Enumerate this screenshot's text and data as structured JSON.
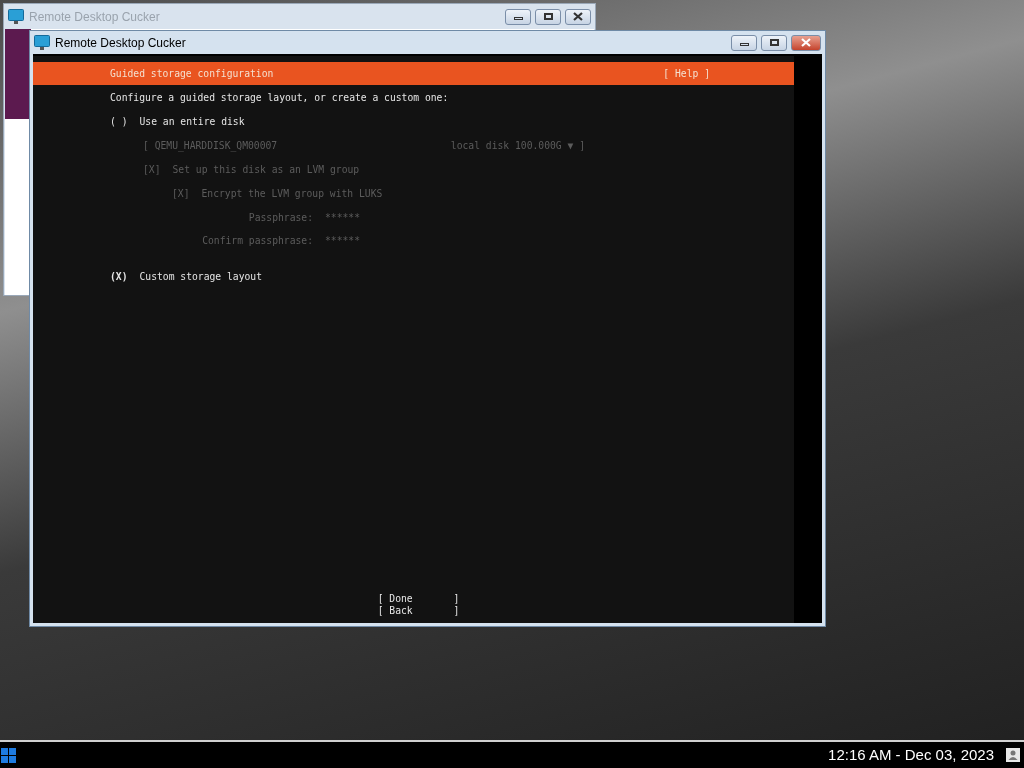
{
  "back_window": {
    "title": "Remote Desktop Cucker"
  },
  "window": {
    "title": "Remote Desktop Cucker"
  },
  "installer": {
    "header": {
      "title": "Guided storage configuration",
      "help": "[ Help ]"
    },
    "intro": "Configure a guided storage layout, or create a custom one:",
    "options": [
      {
        "marker": "( )",
        "label": "Use an entire disk",
        "selected": false,
        "disk": {
          "name": "[ QEMU_HARDDISK_QM00007",
          "size": "local disk 100.000G ▼ ]",
          "disabled": true
        },
        "lvm": {
          "marker": "[X]",
          "label": "Set up this disk as an LVM group",
          "checked": true,
          "disabled": true,
          "encrypt": {
            "marker": "[X]",
            "label": "Encrypt the LVM group with LUKS",
            "checked": true,
            "disabled": true,
            "fields": [
              {
                "label": "Passphrase:",
                "value": "******",
                "disabled": true
              },
              {
                "label": "Confirm passphrase:",
                "value": "******",
                "disabled": true
              }
            ]
          }
        }
      },
      {
        "marker": "(X)",
        "label": "Custom storage layout",
        "selected": true
      }
    ],
    "buttons": [
      "[ Done       ]",
      "[ Back       ]"
    ]
  },
  "taskbar": {
    "clock": "12:16 AM - Dec 03, 2023"
  }
}
